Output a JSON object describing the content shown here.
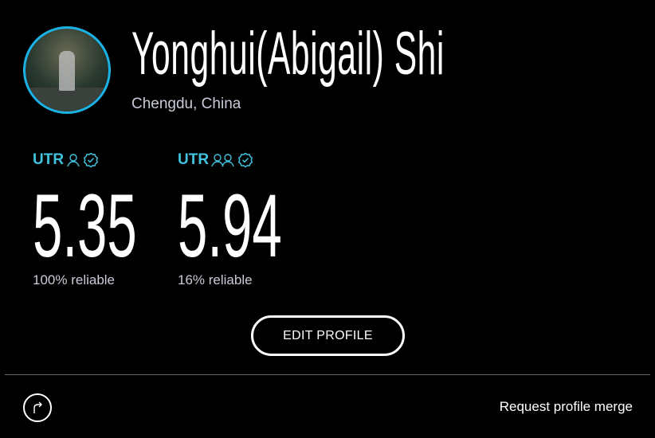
{
  "profile": {
    "name": "Yonghui(Abigail) Shi",
    "location": "Chengdu, China"
  },
  "ratings": [
    {
      "label": "UTR",
      "type": "singles",
      "value": "5.35",
      "reliability": "100% reliable"
    },
    {
      "label": "UTR",
      "type": "doubles",
      "value": "5.94",
      "reliability": "16% reliable"
    }
  ],
  "actions": {
    "edit_profile": "EDIT PROFILE",
    "request_merge": "Request profile merge"
  },
  "colors": {
    "accent": "#3fc3de",
    "avatar_ring": "#1ab3e6"
  }
}
